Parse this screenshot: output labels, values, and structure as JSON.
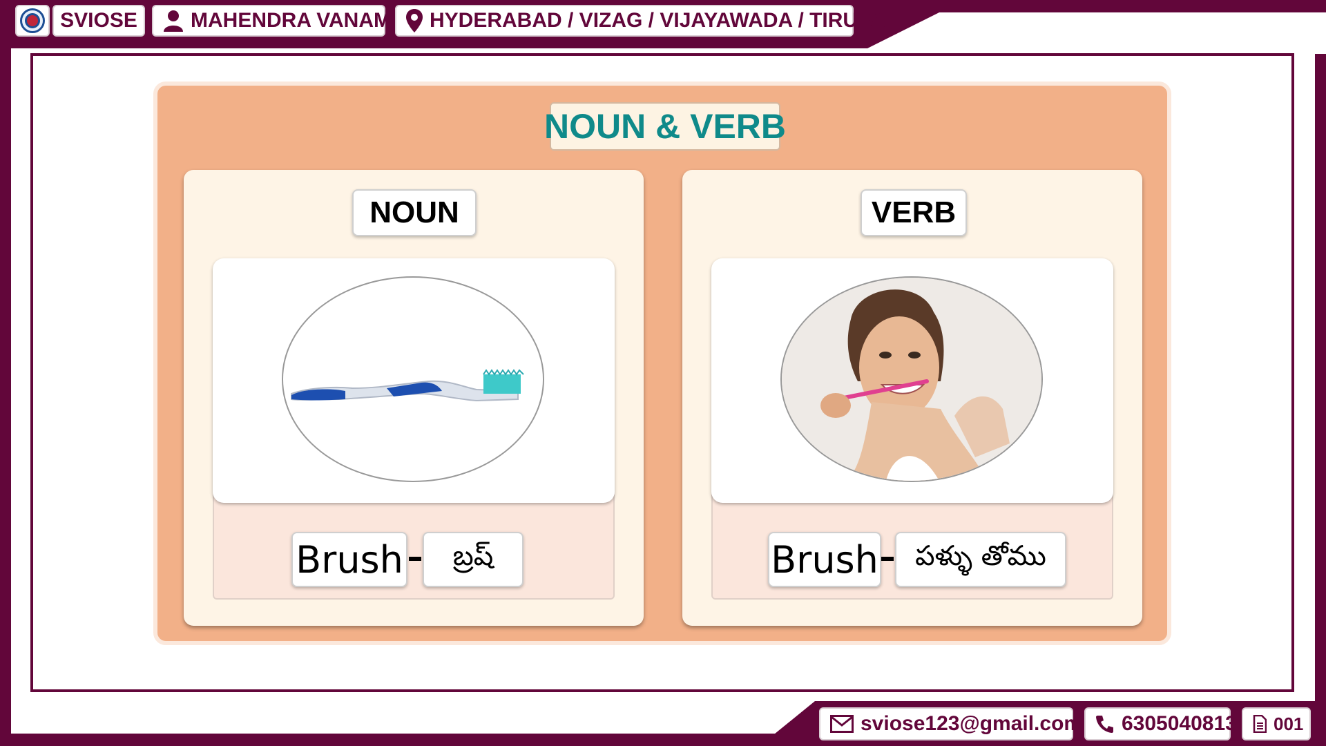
{
  "header": {
    "brand": "SVIOSE",
    "presenter": "MAHENDRA VANAM",
    "locations": "HYDERABAD / VIZAG / VIJAYAWADA / TIRUPATI",
    "icons": [
      "sviose-logo-icon",
      "user-icon",
      "location-pin-icon"
    ]
  },
  "slide": {
    "title": "NOUN & VERB",
    "panels": [
      {
        "label": "NOUN",
        "image": "toothbrush",
        "english": "Brush",
        "telugu": "బ్రష్"
      },
      {
        "label": "VERB",
        "image": "woman-brushing-teeth",
        "english": "Brush",
        "telugu": "పళ్ళు తోము"
      }
    ]
  },
  "footer": {
    "email": "sviose123@gmail.com",
    "phone": "6305040813",
    "page": "001",
    "icons": [
      "mail-icon",
      "phone-icon",
      "document-icon"
    ]
  },
  "colors": {
    "brand": "#62063a",
    "board": "#f2b088",
    "title": "#0f8a8a",
    "panel": "#fef4e6"
  }
}
